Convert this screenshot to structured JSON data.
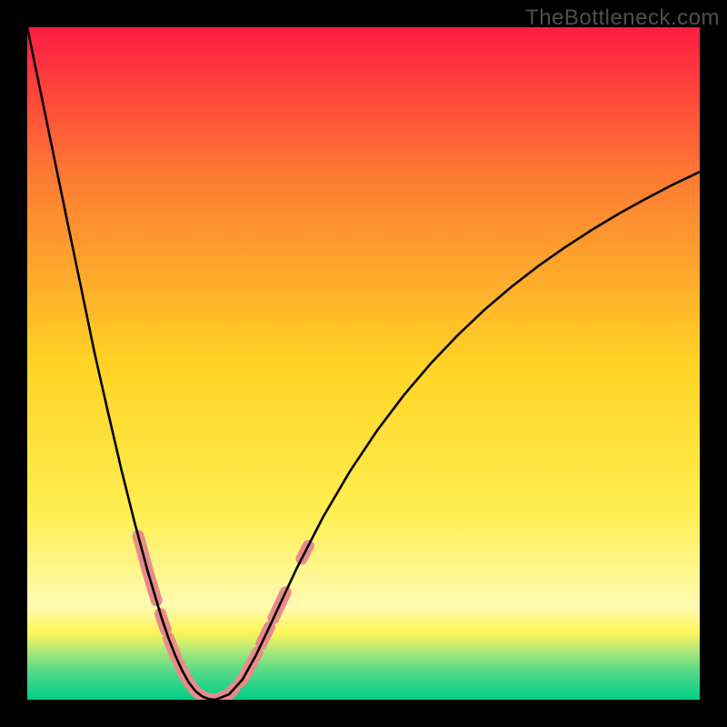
{
  "watermark": "TheBottleneck.com",
  "colors": {
    "black": "#000000",
    "curve_stroke": "#000000",
    "segment_pink": "#e98b8b",
    "grad_top": "#fe1c42",
    "grad_mid_upper": "#fe7a33",
    "grad_mid": "#ffd325",
    "grad_mid_lower": "#ffee50",
    "grad_pale_yellow": "#fffab1",
    "grad_band_yellow": "#fff559",
    "grad_band_green1": "#a4e77a",
    "grad_band_green2": "#4fd889",
    "grad_bottom": "#00cf85"
  },
  "chart_data": {
    "type": "line",
    "title": "",
    "xlabel": "",
    "ylabel": "",
    "xlim": [
      0,
      100
    ],
    "ylim": [
      0,
      100
    ],
    "x": [
      0,
      2,
      4,
      6,
      8,
      10,
      12,
      14,
      16,
      18,
      20,
      21,
      22,
      23,
      24,
      25,
      26,
      27,
      28,
      30,
      32,
      34,
      36,
      38,
      40,
      44,
      48,
      52,
      56,
      60,
      64,
      68,
      72,
      76,
      80,
      84,
      88,
      92,
      96,
      100
    ],
    "values": [
      100,
      90.3,
      80.6,
      70.9,
      61.3,
      51.6,
      42.8,
      34.2,
      26.2,
      18.8,
      12.1,
      9.2,
      6.6,
      4.4,
      2.6,
      1.3,
      0.5,
      0.1,
      0.0,
      0.8,
      3.0,
      6.6,
      10.8,
      15.1,
      19.4,
      27.2,
      34.0,
      40.0,
      45.3,
      50.0,
      54.2,
      58.0,
      61.4,
      64.5,
      67.3,
      69.9,
      72.3,
      74.5,
      76.6,
      78.5
    ],
    "note": "Bottleneck-style V curve. Minimum near x≈27.5 (y≈0). Left arm descends from (0,100) steeply; right arm rises asymptotically toward ~80 at x=100. Pink highlighted segments cluster on both arms in the lower y<38 region.",
    "highlighted_segments_x": [
      [
        16.5,
        19.2
      ],
      [
        19.8,
        20.6
      ],
      [
        21.0,
        22.2
      ],
      [
        22.6,
        24.2
      ],
      [
        24.6,
        25.4
      ],
      [
        25.8,
        30.8
      ],
      [
        31.6,
        34.2
      ],
      [
        34.8,
        36.0
      ],
      [
        36.6,
        38.4
      ],
      [
        40.8,
        41.8
      ]
    ]
  }
}
